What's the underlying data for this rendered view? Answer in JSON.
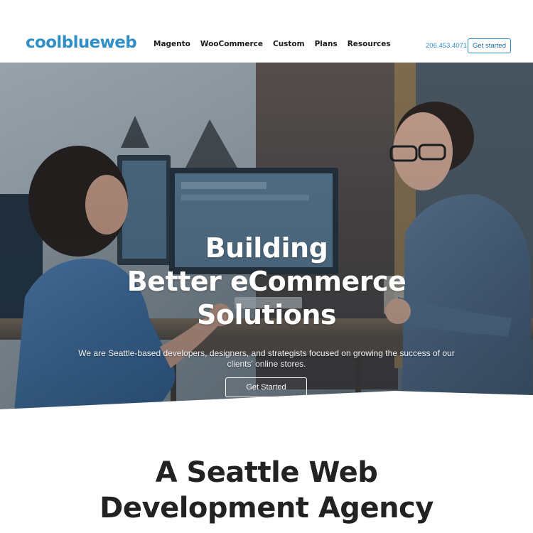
{
  "header": {
    "logo": "coolblueweb",
    "nav": [
      {
        "label": "Magento"
      },
      {
        "label": "WooCommerce"
      },
      {
        "label": "Custom"
      },
      {
        "label": "Plans"
      },
      {
        "label": "Resources"
      }
    ],
    "phone": "206.453.4071",
    "cta_label": "Get started"
  },
  "hero": {
    "title_lines": [
      "Building",
      "Better eCommerce",
      "Solutions"
    ],
    "subtitle": "We are Seattle-based developers, designers, and strategists focused on growing the success of our clients' online stores.",
    "cta_label": "Get Started"
  },
  "section": {
    "heading_lines": [
      "A Seattle Web",
      "Development Agency"
    ]
  },
  "colors": {
    "brand": "#2f8fc6",
    "heading": "#222222",
    "hero_text": "#ffffff"
  }
}
